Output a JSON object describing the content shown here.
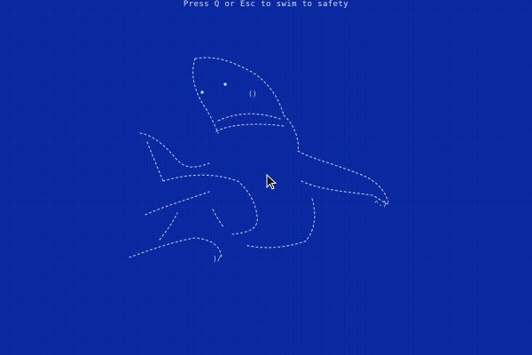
{
  "screen": {
    "instruction_text": "Press Q or Esc to swim to safety",
    "background_color": "#0a2aa6",
    "art_color": "#b8c2ee"
  },
  "art": {
    "subject": "shark-ascii-art",
    "eye_glyph": "()",
    "tail_glyph": "^.)"
  },
  "cursor": {
    "icon": "arrow-pointer-icon"
  }
}
